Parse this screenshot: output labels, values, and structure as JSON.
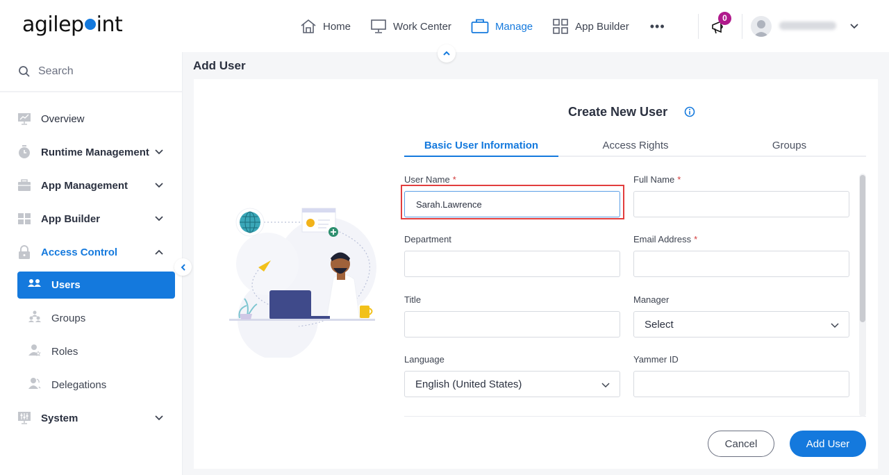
{
  "app": {
    "logo_left": "agilep",
    "logo_right": "int"
  },
  "nav": {
    "items": [
      {
        "label": "Home",
        "icon": "home-icon",
        "active": false
      },
      {
        "label": "Work Center",
        "icon": "monitor-icon",
        "active": false
      },
      {
        "label": "Manage",
        "icon": "briefcase-icon",
        "active": true
      },
      {
        "label": "App Builder",
        "icon": "grid-icon",
        "active": false
      }
    ],
    "more_label": "•••",
    "notification_count": "0"
  },
  "sidebar": {
    "search_placeholder": "Search",
    "items": [
      {
        "label": "Overview",
        "icon": "chart-monitor-icon",
        "expandable": false
      },
      {
        "label": "Runtime Management",
        "icon": "stopwatch-icon",
        "expandable": true
      },
      {
        "label": "App Management",
        "icon": "toolbox-icon",
        "expandable": true
      },
      {
        "label": "App Builder",
        "icon": "app-grid-icon",
        "expandable": true
      },
      {
        "label": "Access Control",
        "icon": "lock-icon",
        "expandable": true,
        "open": true
      },
      {
        "label": "System",
        "icon": "system-settings-icon",
        "expandable": true
      }
    ],
    "access_control_children": [
      {
        "label": "Users",
        "icon": "users-icon",
        "active": true
      },
      {
        "label": "Groups",
        "icon": "groups-icon",
        "active": false
      },
      {
        "label": "Roles",
        "icon": "roles-icon",
        "active": false
      },
      {
        "label": "Delegations",
        "icon": "delegations-icon",
        "active": false
      }
    ]
  },
  "page": {
    "title": "Add User"
  },
  "form": {
    "title": "Create New User",
    "tabs": [
      {
        "label": "Basic User Information",
        "active": true
      },
      {
        "label": "Access Rights",
        "active": false
      },
      {
        "label": "Groups",
        "active": false
      }
    ],
    "fields": {
      "user_name": {
        "label": "User Name",
        "required": "*",
        "value": "Sarah.Lawrence"
      },
      "full_name": {
        "label": "Full Name",
        "required": "*",
        "value": ""
      },
      "department": {
        "label": "Department",
        "value": ""
      },
      "email": {
        "label": "Email Address",
        "required": "*",
        "value": ""
      },
      "title": {
        "label": "Title",
        "value": ""
      },
      "manager": {
        "label": "Manager",
        "value": "Select"
      },
      "language": {
        "label": "Language",
        "value": "English (United States)"
      },
      "yammer_id": {
        "label": "Yammer ID",
        "value": ""
      }
    },
    "cancel_label": "Cancel",
    "submit_label": "Add User"
  },
  "colors": {
    "accent": "#1479dd",
    "badge": "#b0198c",
    "highlight": "#e23d3d",
    "required": "#d23b3b"
  }
}
